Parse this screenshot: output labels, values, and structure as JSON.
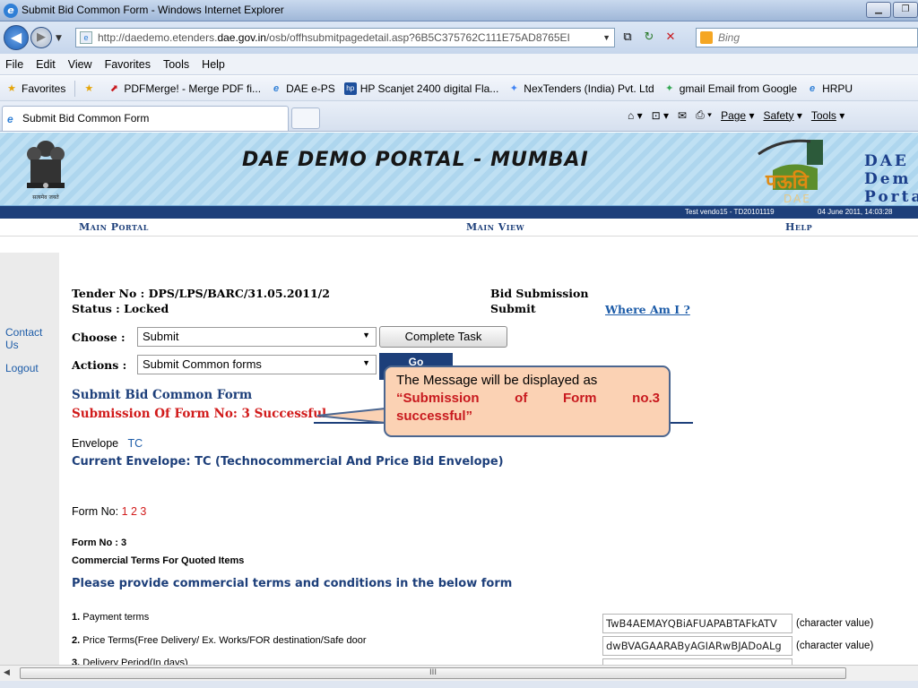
{
  "window": {
    "title": "Submit Bid Common Form - Windows Internet Explorer"
  },
  "address": {
    "url_prefix": "http://daedemo.etenders.",
    "url_domain": "dae.gov.in",
    "url_suffix": "/osb/offhsubmitpagedetail.asp?6B5C375762C111E75AD8765EI",
    "search_placeholder": "Bing"
  },
  "menu": [
    "File",
    "Edit",
    "View",
    "Favorites",
    "Tools",
    "Help"
  ],
  "favorites": {
    "label": "Favorites",
    "items": [
      "PDFMerge! - Merge PDF fi...",
      "DAE e-PS",
      "HP Scanjet 2400 digital Fla...",
      "NexTenders (India) Pvt. Ltd",
      "gmail Email from Google",
      "HRPU"
    ]
  },
  "tab": {
    "label": "Submit Bid Common Form"
  },
  "commandbar": {
    "page": "Page",
    "safety": "Safety",
    "tools": "Tools"
  },
  "banner": {
    "title": "DAE DEMO PORTAL - MUMBAI",
    "logo_text_1": "DAE",
    "logo_text_2": "Dem",
    "logo_text_3": "Porta",
    "logo_hindi": "पऊवि",
    "logo_sub": "DAE",
    "emblem_text": "सत्यमेव जयते"
  },
  "status_strip": {
    "user": "Test vendo15 - TD20101119",
    "datetime": "04 June 2011,  14:03:28"
  },
  "nav": {
    "main_portal": "Main Portal",
    "main_view": "Main View",
    "help": "Help"
  },
  "sidebar": {
    "contact_us": "Contact Us",
    "logout": "Logout"
  },
  "tender": {
    "tender_no": "Tender No : DPS/LPS/BARC/31.05.2011/2",
    "status": "Status : Locked",
    "bid_submission": "Bid Submission",
    "submit": "Submit",
    "where_am_i": "Where Am I ?"
  },
  "controls": {
    "choose_label": "Choose :",
    "choose_value": "Submit",
    "complete_task": "Complete Task",
    "actions_label": "Actions :",
    "actions_value": "Submit Common forms",
    "go": "Go"
  },
  "form": {
    "heading": "Submit Bid Common Form",
    "success": "Submission Of Form No: 3 Successful",
    "envelope_label": "Envelope",
    "envelope_value": "TC",
    "current_envelope": "Current Envelope: TC (Technocommercial And Price Bid Envelope)",
    "form_no_label": "Form No:",
    "form_numbers": "1 2 3",
    "form_no_3": "Form No : 3",
    "form_title": "Commercial Terms For Quoted Items",
    "instruction": "Please provide commercial terms and conditions in the below form",
    "fields": [
      {
        "num": "1.",
        "label": "Payment terms",
        "value": "TwB4AEMAYQBiAFUAPABTAFkATV",
        "hint": "(character value)"
      },
      {
        "num": "2.",
        "label": "Price Terms(Free Delivery/ Ex. Works/FOR destination/Safe door",
        "value": "dwBVAGAARAByAGIARwBJADoALg",
        "hint": "(character value)"
      },
      {
        "num": "3.",
        "label": "Delivery Period(In days)",
        "value": "",
        "hint": ""
      }
    ]
  },
  "callout": {
    "line1": "The  Message will be  displayed as",
    "line2": "“Submission    of    Form    no.3",
    "line3": "successful”"
  },
  "scrollbar": {
    "grip": "III"
  }
}
